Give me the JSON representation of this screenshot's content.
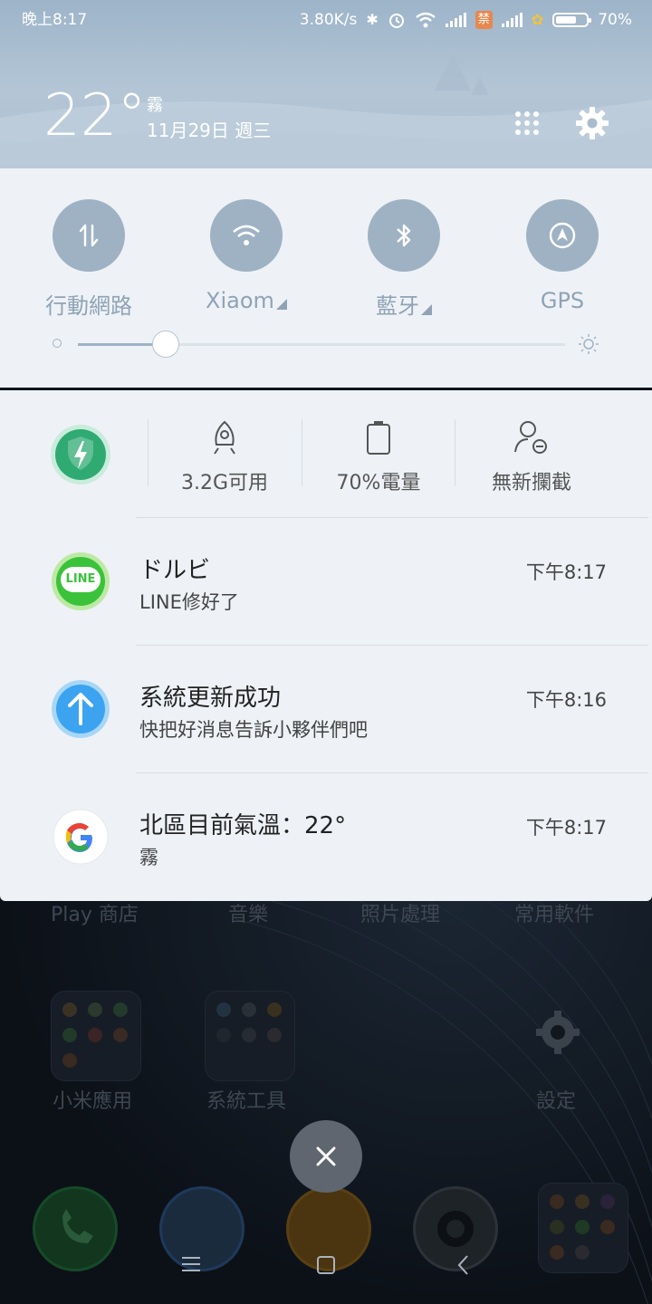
{
  "status_bar": {
    "time": "晚上8:17",
    "net_speed": "3.80K/s",
    "ban_badge": "禁",
    "battery_pct": "70%",
    "battery_level": 0.7
  },
  "weather": {
    "temperature": "22°",
    "condition": "霧",
    "date": "11月29日 週三"
  },
  "quick_settings": {
    "toggles": [
      {
        "label": "行動網路",
        "icon": "mobile-data-icon",
        "has_menu": false
      },
      {
        "label": "Xiaom",
        "icon": "wifi-icon",
        "has_menu": true
      },
      {
        "label": "藍牙",
        "icon": "bluetooth-icon",
        "has_menu": true
      },
      {
        "label": "GPS",
        "icon": "gps-icon",
        "has_menu": false
      }
    ],
    "brightness_level": 0.18
  },
  "security_bar": {
    "items": [
      {
        "label": "3.2G可用",
        "icon": "rocket-icon"
      },
      {
        "label": "70%電量",
        "icon": "battery-icon"
      },
      {
        "label": "無新攔截",
        "icon": "block-user-icon"
      }
    ]
  },
  "notifications": [
    {
      "title": "ドルビ",
      "body": "LINE修好了",
      "time": "下午8:17",
      "app": "LINE",
      "icon": "line-icon"
    },
    {
      "title": "系統更新成功",
      "body": "快把好消息告訴小夥伴們吧",
      "time": "下午8:16",
      "icon": "update-icon"
    },
    {
      "title": "北區目前氣溫：22°",
      "body": "霧",
      "time": "下午8:17",
      "icon": "google-icon"
    }
  ],
  "home": {
    "row1_labels": [
      "Play 商店",
      "音樂",
      "照片處理",
      "常用軟件"
    ],
    "folders": [
      "小米應用",
      "系統工具"
    ],
    "settings_label": "設定"
  },
  "colors": {
    "accent": "#9fb2c4",
    "line_green": "#3ac33a",
    "update_blue": "#3ba3f0",
    "security_green": "#2faa72"
  }
}
